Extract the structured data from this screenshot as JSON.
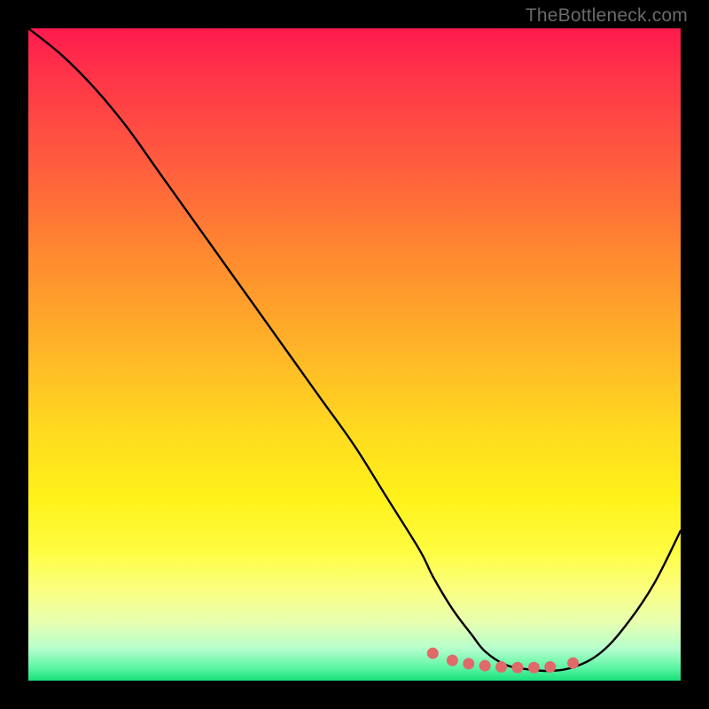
{
  "watermark": "TheBottleneck.com",
  "chart_data": {
    "type": "line",
    "title": "",
    "xlabel": "",
    "ylabel": "",
    "xlim": [
      0,
      100
    ],
    "ylim": [
      0,
      100
    ],
    "series": [
      {
        "name": "bottleneck-curve",
        "x": [
          0,
          5,
          10,
          15,
          20,
          25,
          30,
          35,
          40,
          45,
          50,
          55,
          60,
          62,
          65,
          68,
          70,
          73,
          76,
          80,
          84,
          88,
          92,
          96,
          100
        ],
        "values": [
          100,
          96,
          91,
          85,
          78,
          71,
          64,
          57,
          50,
          43,
          36,
          28,
          20,
          16,
          11,
          7,
          4.5,
          2.5,
          1.8,
          1.5,
          2.2,
          4.5,
          9,
          15,
          23
        ]
      }
    ],
    "markers": {
      "name": "optimal-range-dots",
      "x": [
        62,
        65,
        67.5,
        70,
        72.5,
        75,
        77.5,
        80,
        83.5
      ],
      "values": [
        4.2,
        3.1,
        2.6,
        2.3,
        2.1,
        2.0,
        2.0,
        2.1,
        2.7
      ],
      "color": "#e06a6a",
      "radius": 6.5
    },
    "gradient_stops": [
      {
        "pos": 0,
        "color": "#ff1a4f"
      },
      {
        "pos": 8,
        "color": "#ff3747"
      },
      {
        "pos": 20,
        "color": "#ff5a3f"
      },
      {
        "pos": 35,
        "color": "#ff8a2f"
      },
      {
        "pos": 50,
        "color": "#ffb727"
      },
      {
        "pos": 62,
        "color": "#ffdb1f"
      },
      {
        "pos": 72,
        "color": "#fff21a"
      },
      {
        "pos": 80,
        "color": "#fffc40"
      },
      {
        "pos": 86,
        "color": "#fbff80"
      },
      {
        "pos": 91,
        "color": "#e8ffb0"
      },
      {
        "pos": 95,
        "color": "#b7ffcd"
      },
      {
        "pos": 98,
        "color": "#5ef5a5"
      },
      {
        "pos": 100,
        "color": "#18e07a"
      }
    ]
  }
}
